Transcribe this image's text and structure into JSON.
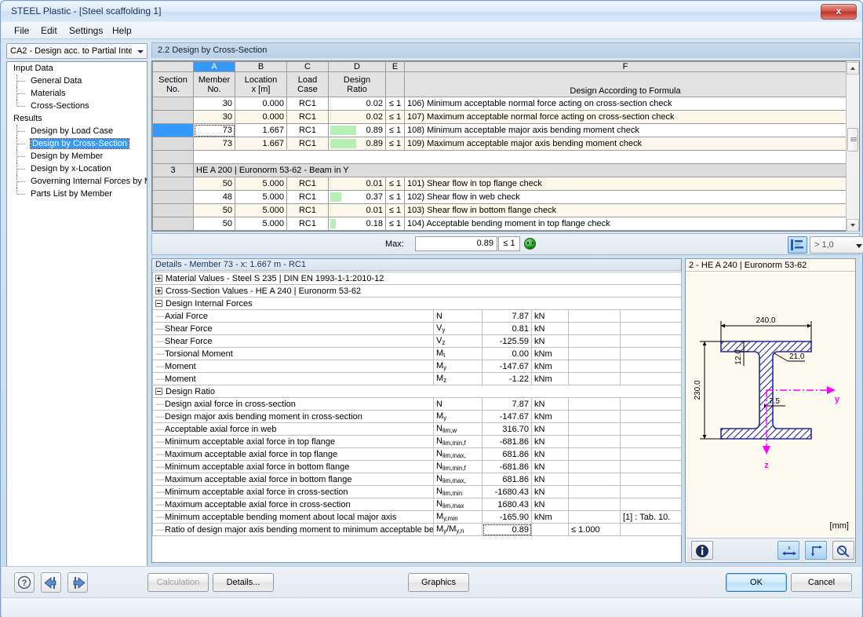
{
  "window": {
    "title": "STEEL Plastic - [Steel scaffolding 1]",
    "close_label": "x"
  },
  "menu": {
    "items": [
      "File",
      "Edit",
      "Settings",
      "Help"
    ]
  },
  "sidebar": {
    "combo_value": "CA2 - Design acc. to Partial Inte",
    "tree": [
      {
        "label": "Input Data",
        "type": "root"
      },
      {
        "label": "General Data",
        "type": "child"
      },
      {
        "label": "Materials",
        "type": "child"
      },
      {
        "label": "Cross-Sections",
        "type": "child",
        "last": true
      },
      {
        "label": "Results",
        "type": "root"
      },
      {
        "label": "Design by Load Case",
        "type": "child"
      },
      {
        "label": "Design by Cross-Section",
        "type": "child",
        "selected": true
      },
      {
        "label": "Design by Member",
        "type": "child"
      },
      {
        "label": "Design by x-Location",
        "type": "child"
      },
      {
        "label": "Governing Internal Forces by M",
        "type": "child"
      },
      {
        "label": "Parts List by Member",
        "type": "child",
        "last": true
      }
    ]
  },
  "tab": {
    "title": "2.2 Design by Cross-Section"
  },
  "grid": {
    "column_letters": [
      "",
      "A",
      "B",
      "C",
      "D",
      "E",
      "F"
    ],
    "active_letter": "A",
    "headers": {
      "section": [
        "Section",
        "No."
      ],
      "member": [
        "Member",
        "No."
      ],
      "location": [
        "Location",
        "x [m]"
      ],
      "loadcase": [
        "Load",
        "Case"
      ],
      "ratio": [
        "Design",
        "Ratio"
      ],
      "e": [
        "",
        ""
      ],
      "formula": [
        "",
        "Design According to Formula"
      ]
    },
    "rows": [
      {
        "kind": "data",
        "section": "",
        "member": "30",
        "location": "0.000",
        "loadcase": "RC1",
        "bar_pct": 2,
        "ratio": "0.02",
        "e": "≤ 1",
        "formula": "106) Minimum acceptable normal force acting on cross-section check",
        "band": "even",
        "selected": false
      },
      {
        "kind": "data",
        "section": "",
        "member": "30",
        "location": "0.000",
        "loadcase": "RC1",
        "bar_pct": 2,
        "ratio": "0.02",
        "e": "≤ 1",
        "formula": "107) Maximum acceptable normal force acting on cross-section check",
        "band": "odd",
        "selected": false
      },
      {
        "kind": "data",
        "section": "",
        "member": "73",
        "location": "1.667",
        "loadcase": "RC1",
        "bar_pct": 89,
        "ratio": "0.89",
        "e": "≤ 1",
        "formula": "108) Minimum acceptable major axis bending moment check",
        "band": "even",
        "selected": true
      },
      {
        "kind": "data",
        "section": "",
        "member": "73",
        "location": "1.667",
        "loadcase": "RC1",
        "bar_pct": 89,
        "ratio": "0.89",
        "e": "≤ 1",
        "formula": "109) Maximum acceptable major axis bending moment check",
        "band": "odd",
        "selected": false
      },
      {
        "kind": "blank"
      },
      {
        "kind": "section",
        "section": "3",
        "title": "HE A 200 | Euronorm 53-62 - Beam in Y"
      },
      {
        "kind": "data",
        "section": "",
        "member": "50",
        "location": "5.000",
        "loadcase": "RC1",
        "bar_pct": 1,
        "ratio": "0.01",
        "e": "≤ 1",
        "formula": "101) Shear flow in top flange check",
        "band": "odd",
        "selected": false
      },
      {
        "kind": "data",
        "section": "",
        "member": "48",
        "location": "5.000",
        "loadcase": "RC1",
        "bar_pct": 37,
        "ratio": "0.37",
        "e": "≤ 1",
        "formula": "102) Shear flow in web check",
        "band": "even",
        "selected": false
      },
      {
        "kind": "data",
        "section": "",
        "member": "50",
        "location": "5.000",
        "loadcase": "RC1",
        "bar_pct": 1,
        "ratio": "0.01",
        "e": "≤ 1",
        "formula": "103) Shear flow in bottom flange check",
        "band": "odd",
        "selected": false
      },
      {
        "kind": "data",
        "section": "",
        "member": "50",
        "location": "5.000",
        "loadcase": "RC1",
        "bar_pct": 18,
        "ratio": "0.18",
        "e": "≤ 1",
        "formula": "104) Acceptable bending moment in top flange check",
        "band": "even",
        "selected": false
      }
    ]
  },
  "maxbar": {
    "label": "Max:",
    "value": "0.89",
    "le_label": "≤ 1",
    "filter_value": "> 1,0",
    "icons": [
      "color-bars-icon",
      "filter-icon",
      "printer-icon",
      "excel-export-icon",
      "pick-member-icon",
      "view-mode-icon"
    ]
  },
  "details": {
    "title": "Details - Member 73 - x: 1.667 m - RC1",
    "groups": [
      {
        "type": "collapsed",
        "label": "Material Values - Steel S 235 | DIN EN 1993-1-1:2010-12"
      },
      {
        "type": "collapsed",
        "label": "Cross-Section Values  -  HE A 240 | Euronorm 53-62"
      },
      {
        "type": "expanded",
        "label": "Design Internal Forces"
      }
    ],
    "internal_forces": [
      {
        "desc": "Axial Force",
        "sym": "N",
        "sub": "",
        "value": "7.87",
        "unit": "kN",
        "cond": "",
        "ref": ""
      },
      {
        "desc": "Shear Force",
        "sym": "V",
        "sub": "y",
        "value": "0.81",
        "unit": "kN",
        "cond": "",
        "ref": ""
      },
      {
        "desc": "Shear Force",
        "sym": "V",
        "sub": "z",
        "value": "-125.59",
        "unit": "kN",
        "cond": "",
        "ref": ""
      },
      {
        "desc": "Torsional Moment",
        "sym": "M",
        "sub": "t",
        "value": "0.00",
        "unit": "kNm",
        "cond": "",
        "ref": ""
      },
      {
        "desc": "Moment",
        "sym": "M",
        "sub": "y",
        "value": "-147.67",
        "unit": "kNm",
        "cond": "",
        "ref": ""
      },
      {
        "desc": "Moment",
        "sym": "M",
        "sub": "z",
        "value": "-1.22",
        "unit": "kNm",
        "cond": "",
        "ref": ""
      }
    ],
    "ratio_group_label": "Design Ratio",
    "design_ratio": [
      {
        "desc": "Design axial force in cross-section",
        "sym": "N",
        "sub": "",
        "value": "7.87",
        "unit": "kN",
        "cond": "",
        "ref": "",
        "focus": false
      },
      {
        "desc": "Design major axis bending moment in cross-section",
        "sym": "M",
        "sub": "y",
        "value": "-147.67",
        "unit": "kNm",
        "cond": "",
        "ref": "",
        "focus": false
      },
      {
        "desc": "Acceptable axial force in web",
        "sym": "N",
        "sub": "lim,w",
        "value": "316.70",
        "unit": "kN",
        "cond": "",
        "ref": "",
        "focus": false
      },
      {
        "desc": "Minimum acceptable axial force in top flange",
        "sym": "N",
        "sub": "lim,min,f",
        "value": "-681.86",
        "unit": "kN",
        "cond": "",
        "ref": "",
        "focus": false
      },
      {
        "desc": "Maximum acceptable axial force in top flange",
        "sym": "N",
        "sub": "lim,max,",
        "value": "681.86",
        "unit": "kN",
        "cond": "",
        "ref": "",
        "focus": false
      },
      {
        "desc": "Minimum acceptable axial force in bottom flange",
        "sym": "N",
        "sub": "lim,min,f",
        "value": "-681.86",
        "unit": "kN",
        "cond": "",
        "ref": "",
        "focus": false
      },
      {
        "desc": "Maximum acceptable axial force in bottom flange",
        "sym": "N",
        "sub": "lim,max,",
        "value": "681.86",
        "unit": "kN",
        "cond": "",
        "ref": "",
        "focus": false
      },
      {
        "desc": "Minimum acceptable axial force in cross-section",
        "sym": "N",
        "sub": "lim,min",
        "value": "-1680.43",
        "unit": "kN",
        "cond": "",
        "ref": "",
        "focus": false
      },
      {
        "desc": "Maximum acceptable axial force in cross-section",
        "sym": "N",
        "sub": "lim,max",
        "value": "1680.43",
        "unit": "kN",
        "cond": "",
        "ref": "",
        "focus": false
      },
      {
        "desc": "Minimum acceptable bending moment about local major axis",
        "sym": "M",
        "sub": "y,min",
        "value": "-165.90",
        "unit": "kNm",
        "cond": "",
        "ref": "[1] : Tab. 10.",
        "focus": false
      },
      {
        "desc": "Ratio of design major axis bending moment to minimum acceptable bend",
        "sym": "M",
        "sub": "",
        "symraw": "My/My,n",
        "value": "0.89",
        "unit": "",
        "cond": "≤ 1.000",
        "ref": "",
        "focus": true
      }
    ]
  },
  "cross_section": {
    "title": "2 - HE A 240 | Euronorm 53-62",
    "units": "[mm]",
    "dimensions": {
      "width": "240.0",
      "height": "230.0",
      "flange_thickness": "12.0",
      "web_thickness": "7.5",
      "root_radius": "21.0"
    },
    "axes": {
      "horizontal": "y",
      "vertical": "z"
    },
    "toolbar_icons": [
      "info-icon",
      "dimensions-x-icon",
      "axes-icon",
      "zoom-reset-icon"
    ]
  },
  "bottom": {
    "nav_icons": [
      "help-icon",
      "previous-icon",
      "next-icon"
    ],
    "buttons": [
      {
        "label": "Calculation",
        "disabled": true
      },
      {
        "label": "Details...",
        "disabled": false
      },
      {
        "label": "Graphics",
        "disabled": false
      },
      {
        "label": "OK",
        "default": true
      },
      {
        "label": "Cancel",
        "default": false
      }
    ]
  },
  "colors": {
    "accent_blue": "#3399ff",
    "ratio_green": "#b6f0b6",
    "section_steel": "#2a2a9c",
    "axis_magenta": "#ff00ff",
    "row_alt": "#fdf8ec"
  }
}
